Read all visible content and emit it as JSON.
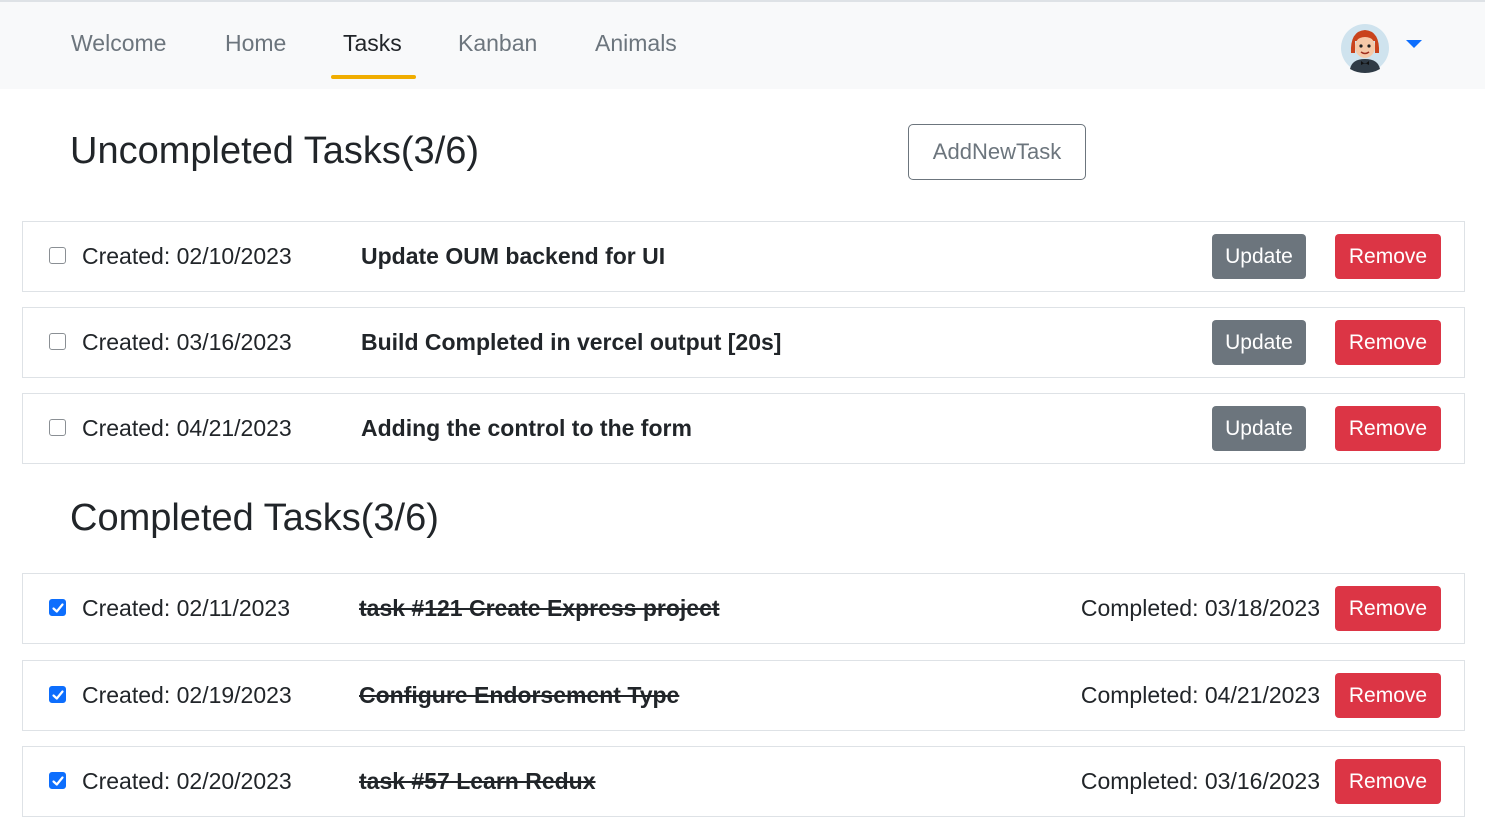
{
  "nav": {
    "items": [
      {
        "label": "Welcome"
      },
      {
        "label": "Home"
      },
      {
        "label": "Tasks"
      },
      {
        "label": "Kanban"
      },
      {
        "label": "Animals"
      }
    ],
    "active": "Tasks",
    "accent_color": "#f0ad00"
  },
  "user_menu": {
    "avatar": "avatar-icon",
    "caret": "caret-down-icon"
  },
  "uncompleted": {
    "title": "Uncompleted Tasks(3/6)",
    "add_button_label": "AddNewTask",
    "tasks": [
      {
        "created": "Created: 02/10/2023",
        "title": "Update OUM backend for UI",
        "update_label": "Update",
        "remove_label": "Remove",
        "checked": false
      },
      {
        "created": "Created: 03/16/2023",
        "title": "Build Completed in vercel output [20s]",
        "update_label": "Update",
        "remove_label": "Remove",
        "checked": false
      },
      {
        "created": "Created: 04/21/2023",
        "title": "Adding the control to the form",
        "update_label": "Update",
        "remove_label": "Remove",
        "checked": false
      }
    ]
  },
  "completed": {
    "title": "Completed Tasks(3/6)",
    "tasks": [
      {
        "created": "Created: 02/11/2023",
        "title": "task #121 Create Express project",
        "completed": "Completed: 03/18/2023",
        "remove_label": "Remove",
        "checked": true
      },
      {
        "created": "Created: 02/19/2023",
        "title": "Configure Endorsement Type",
        "completed": "Completed: 04/21/2023",
        "remove_label": "Remove",
        "checked": true
      },
      {
        "created": "Created: 02/20/2023",
        "title": "task #57 Learn Redux",
        "completed": "Completed: 03/16/2023",
        "remove_label": "Remove",
        "checked": true
      }
    ]
  },
  "colors": {
    "update": "#6c757d",
    "remove": "#dc3545",
    "checkbox": "#0d6efd"
  }
}
